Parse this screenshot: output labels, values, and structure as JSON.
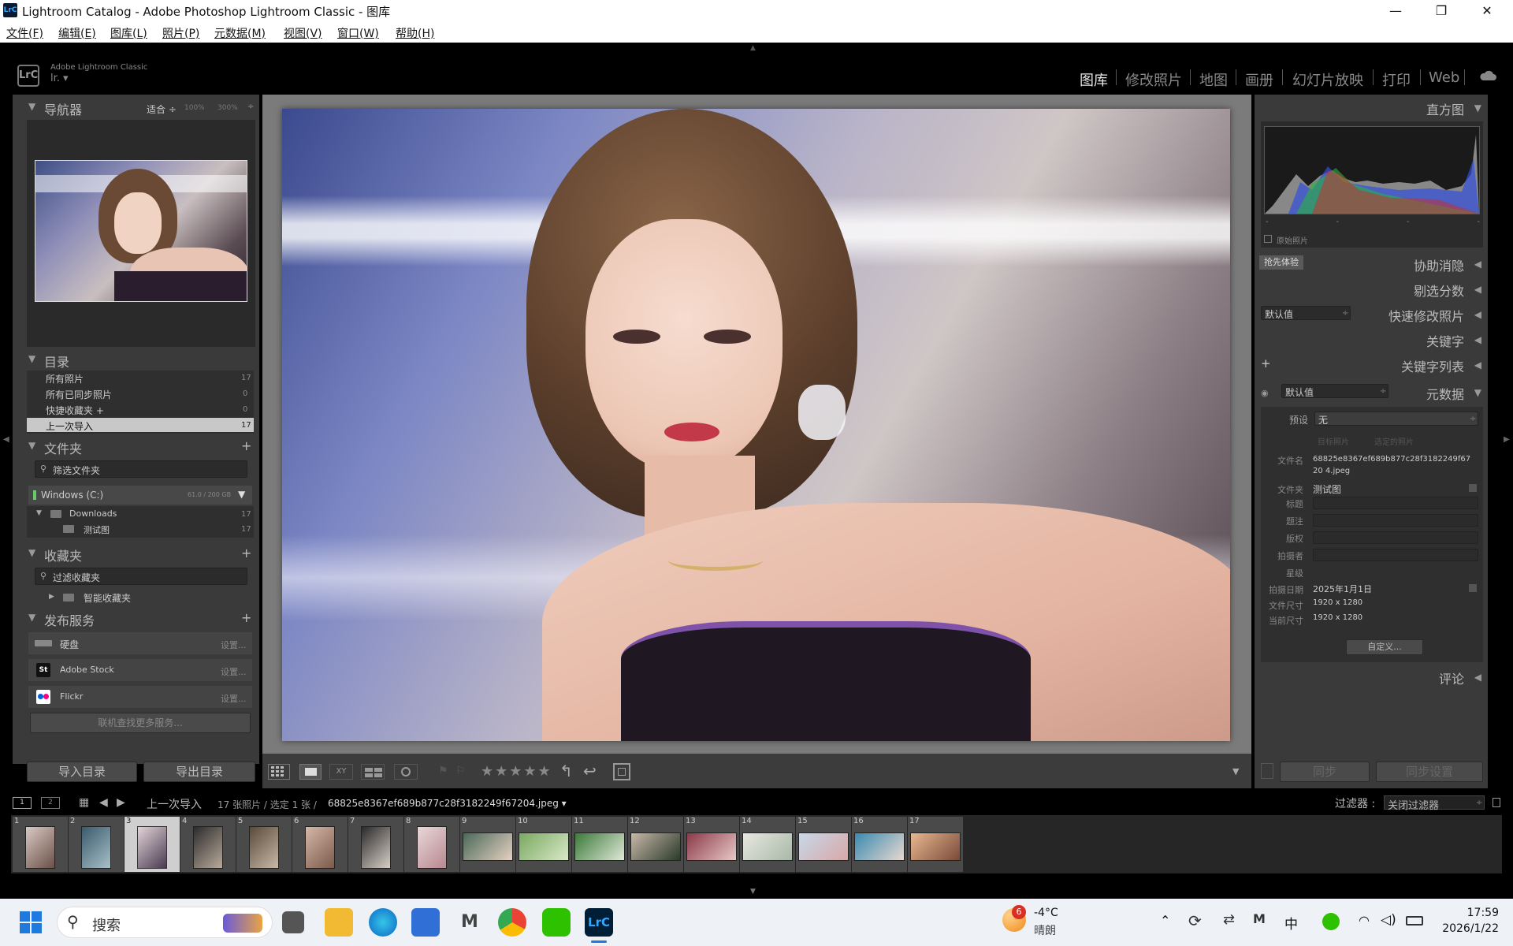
{
  "window": {
    "title": "Lightroom Catalog - Adobe Photoshop Lightroom Classic - 图库",
    "app_badge": "LrC",
    "minimize": "—",
    "restore": "❐",
    "close": "✕"
  },
  "menu": [
    "文件(F)",
    "编辑(E)",
    "图库(L)",
    "照片(P)",
    "元数据(M)",
    "视图(V)",
    "窗口(W)",
    "帮助(H)"
  ],
  "identity": {
    "logo": "LrC",
    "brand": "Adobe Lightroom Classic",
    "user": "lr.  ▾",
    "modules": [
      "图库",
      "修改照片",
      "地图",
      "画册",
      "幻灯片放映",
      "打印",
      "Web"
    ],
    "active_module": "图库"
  },
  "navigator": {
    "title": "导航器",
    "zoom_options": [
      "适合 ÷",
      "100%",
      "300%",
      "÷"
    ]
  },
  "catalog": {
    "title": "目录",
    "items": [
      {
        "label": "所有照片",
        "count": "17"
      },
      {
        "label": "所有已同步照片",
        "count": "0"
      },
      {
        "label": "快捷收藏夹 +",
        "count": "0"
      },
      {
        "label": "上一次导入",
        "count": "17"
      }
    ]
  },
  "folders": {
    "title": "文件夹",
    "add": "+",
    "filter": "筛选文件夹",
    "volume": "Windows (C:)",
    "volume_size": "61.0 / 200 GB",
    "items": [
      {
        "label": "Downloads",
        "count": "17"
      },
      {
        "label": "测试图",
        "count": "17"
      }
    ]
  },
  "collections": {
    "title": "收藏夹",
    "add": "+",
    "filter": "过滤收藏夹",
    "smart": "智能收藏夹"
  },
  "publish": {
    "title": "发布服务",
    "add": "+",
    "services": [
      {
        "name": "硬盘",
        "action": "设置..."
      },
      {
        "name": "Adobe Stock",
        "action": "设置..."
      },
      {
        "name": "Flickr",
        "action": "设置..."
      }
    ],
    "find_more": "联机查找更多服务..."
  },
  "left_buttons": {
    "import": "导入目录",
    "export": "导出目录"
  },
  "right_panel": {
    "histogram_title": "直方图",
    "histogram_ticks": [
      "-",
      "-",
      "-",
      "-"
    ],
    "original_photo": "原始照片",
    "assist_badge": "抢先体验",
    "assist": "协助消隐",
    "cull": "剔选分数",
    "quick_develop": "快速修改照片",
    "quick_preset": "默认值",
    "keywords": "关键字",
    "keyword_list": "关键字列表",
    "keyword_add": "+",
    "metadata_preset": "默认值",
    "metadata_title": "元数据",
    "preset_label": "预设",
    "preset_value": "无",
    "tab_target": "目标照片",
    "tab_selected": "选定的照片",
    "fields": [
      {
        "label": "文件名",
        "value": "68825e8367ef689b877c28f3182249f6720 4.jpeg"
      },
      {
        "label": "文件夹",
        "value": "测试图"
      },
      {
        "label": "标题",
        "value": ""
      },
      {
        "label": "题注",
        "value": ""
      },
      {
        "label": "版权",
        "value": ""
      },
      {
        "label": "拍摄者",
        "value": ""
      },
      {
        "label": "星级",
        "value": ""
      },
      {
        "label": "拍摄日期",
        "value": "2025年1月1日"
      },
      {
        "label": "文件尺寸",
        "value": "1920 x 1280"
      },
      {
        "label": "当前尺寸",
        "value": "1920 x 1280"
      }
    ],
    "customize": "自定义...",
    "comments": "评论",
    "sync": "同步",
    "sync_settings": "同步设置"
  },
  "toolbar": {
    "stars": "★★★★★"
  },
  "filmstrip_bar": {
    "monitor1": "1",
    "monitor2": "2",
    "source": "上一次导入",
    "info": "17 张照片 / 选定 1 张 / ",
    "filename": "68825e8367ef689b877c28f3182249f67204.jpeg ▾",
    "filter_label": "过滤器 :",
    "filter_value": "关闭过滤器"
  },
  "filmstrip": {
    "numbers": [
      "1",
      "2",
      "3",
      "4",
      "5",
      "6",
      "7",
      "8",
      "9",
      "10",
      "11",
      "12",
      "13",
      "14",
      "15",
      "16",
      "17"
    ],
    "selected_index": 3
  },
  "taskbar": {
    "search": "搜索",
    "weather_temp": "-4°C",
    "weather_desc": "晴朗",
    "weather_badge": "6",
    "ime": "中",
    "time": "17:59",
    "date": "2026/1/22"
  }
}
